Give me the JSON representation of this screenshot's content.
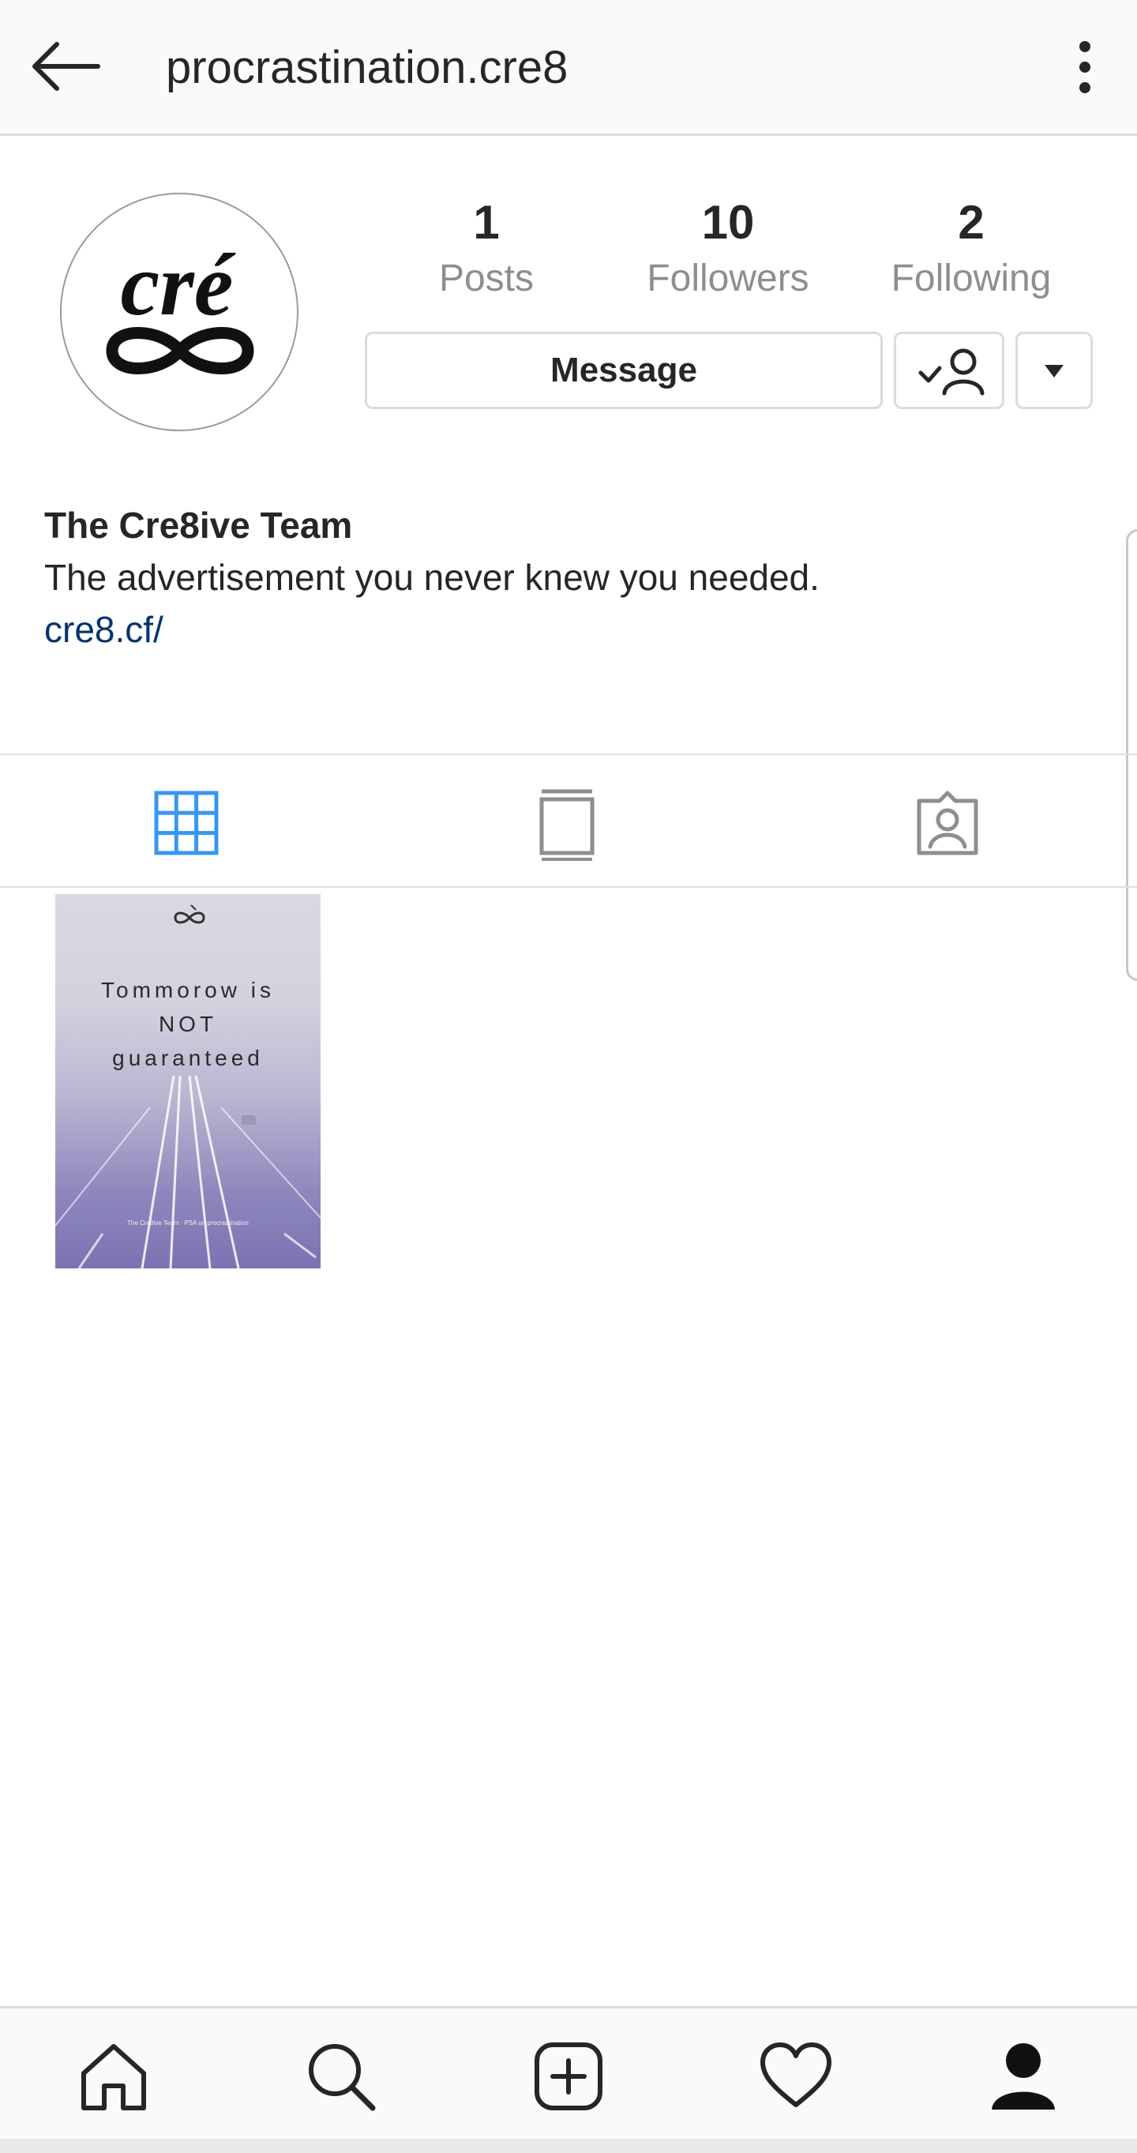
{
  "header": {
    "username": "procrastination.cre8",
    "back_icon": "arrow-left-icon",
    "menu_icon": "more-vertical-icon"
  },
  "profile": {
    "avatar_logo": "cré ∞",
    "stats": [
      {
        "value": "1",
        "label": "Posts"
      },
      {
        "value": "10",
        "label": "Followers"
      },
      {
        "value": "2",
        "label": "Following"
      }
    ],
    "message_label": "Message",
    "following_icon": "user-check-icon",
    "dropdown_icon": "caret-down-icon"
  },
  "bio": {
    "name": "The Cre8ive Team",
    "text": "The advertisement you never knew you needed.",
    "link": "cre8.cf/"
  },
  "tabs": [
    {
      "icon": "grid-icon",
      "active": true
    },
    {
      "icon": "feed-list-icon",
      "active": false
    },
    {
      "icon": "tagged-icon",
      "active": false
    }
  ],
  "posts": [
    {
      "text_lines": [
        "Tommorow is",
        "NOT",
        "guaranteed"
      ],
      "caption": "The Cre8ive Team · PSA on procrastination"
    }
  ],
  "bottom_nav": [
    {
      "icon": "home-icon"
    },
    {
      "icon": "search-icon"
    },
    {
      "icon": "add-post-icon"
    },
    {
      "icon": "activity-heart-icon"
    },
    {
      "icon": "profile-icon",
      "active": true
    }
  ],
  "colors": {
    "accent_active_tab": "#3897f0",
    "link": "#003569",
    "muted_text": "#8e8e8e",
    "border": "#dbdbdb"
  }
}
